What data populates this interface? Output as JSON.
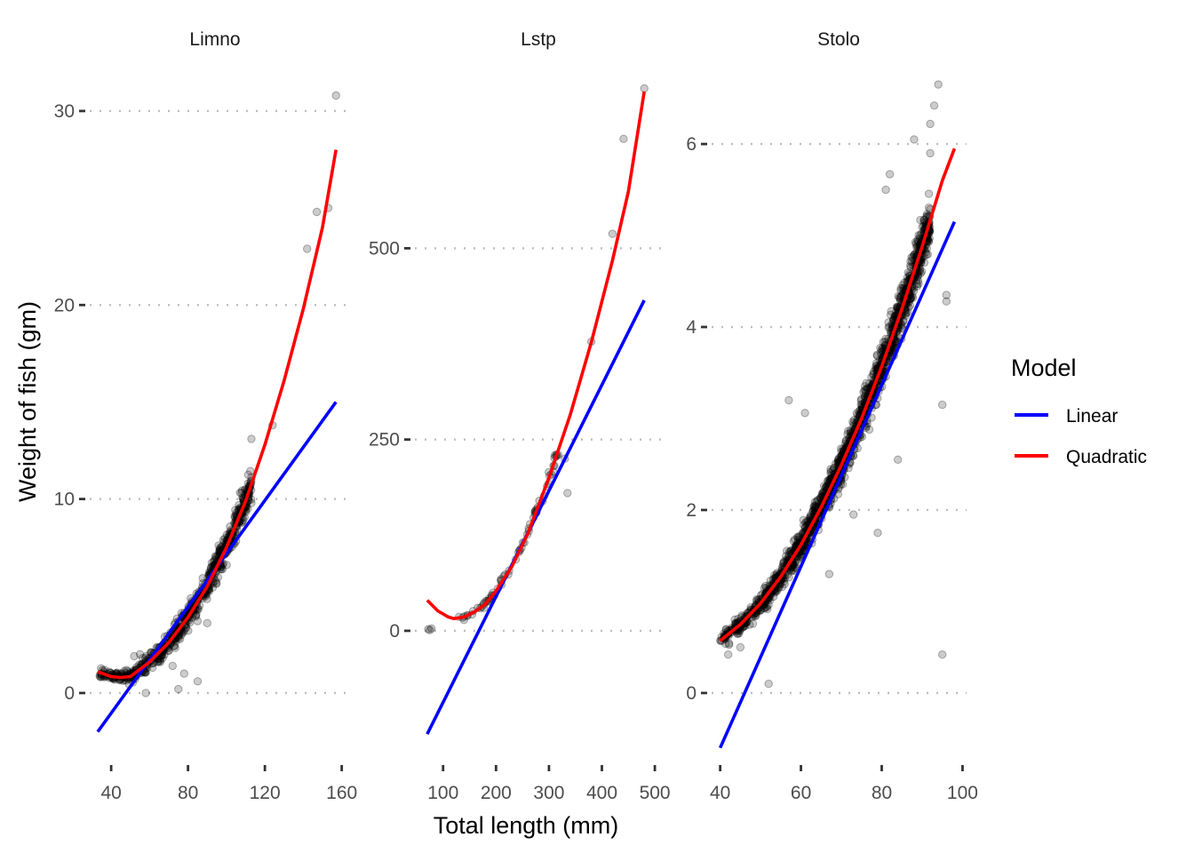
{
  "chart_data": {
    "type": "scatter",
    "layout": "faceted-3-panels",
    "xlabel": "Total length (mm)",
    "ylabel": "Weight of fish (gm)",
    "legend": {
      "title": "Model",
      "placement": "right",
      "entries": [
        {
          "name": "Linear",
          "color": "#0000ff"
        },
        {
          "name": "Quadratic",
          "color": "#ff0000"
        }
      ]
    },
    "grid": "horizontal major dotted",
    "panels": [
      {
        "title": "Limno",
        "xlim": [
          27,
          162
        ],
        "ylim": [
          -3.3,
          31.6
        ],
        "xticks": [
          40,
          80,
          120,
          160
        ],
        "yticks": [
          0,
          10,
          20,
          30
        ],
        "fits": {
          "Linear": {
            "x": [
              33,
              157
            ],
            "y": [
              -2.0,
              15.0
            ]
          },
          "Quadratic": {
            "x": [
              33,
              40,
              45,
              50,
              60,
              70,
              80,
              90,
              100,
              110,
              120,
              130,
              140,
              150,
              157
            ],
            "y": [
              1.1,
              0.85,
              0.8,
              0.85,
              1.6,
              2.6,
              3.9,
              5.5,
              7.5,
              9.9,
              12.8,
              16.1,
              19.8,
              24.0,
              28.0
            ]
          }
        },
        "cloud": {
          "x_range": [
            33,
            113
          ],
          "curve": "quadratic",
          "spread": 0.9,
          "n": 700
        },
        "outliers": [
          [
            157,
            30.8
          ],
          [
            147,
            24.8
          ],
          [
            153,
            25.0
          ],
          [
            142,
            22.9
          ],
          [
            124,
            13.8
          ],
          [
            113,
            13.1
          ],
          [
            85,
            0.6
          ],
          [
            75,
            0.2
          ],
          [
            78,
            1.0
          ],
          [
            58,
            0.0
          ],
          [
            72,
            1.4
          ],
          [
            52,
            1.9
          ],
          [
            55,
            2.0
          ],
          [
            90,
            3.6
          ]
        ]
      },
      {
        "title": "Lstp",
        "xlim": [
          40,
          525
        ],
        "ylim": [
          -165,
          720
        ],
        "xticks": [
          100,
          200,
          300,
          400,
          500
        ],
        "yticks": [
          0,
          250,
          500
        ],
        "fits": {
          "Linear": {
            "x": [
              70,
              480
            ],
            "y": [
              -135,
              432
            ]
          },
          "Quadratic": {
            "x": [
              70,
              90,
              110,
              120,
              140,
              160,
              180,
              200,
              230,
              260,
              300,
              340,
              380,
              420,
              450,
              480
            ],
            "y": [
              40,
              26,
              18,
              16,
              18,
              25,
              35,
              52,
              84,
              127,
              200,
              282,
              377,
              484,
              574,
              705
            ]
          }
        },
        "cloud": {
          "x_range": [
            120,
            320
          ],
          "curve": "quadratic",
          "spread": 10,
          "n": 70
        },
        "outliers": [
          [
            72,
            2
          ],
          [
            78,
            3
          ],
          [
            75,
            1
          ],
          [
            441,
            643
          ],
          [
            480,
            709
          ],
          [
            420,
            519
          ],
          [
            380,
            378
          ],
          [
            335,
            180
          ],
          [
            330,
            225
          ]
        ]
      },
      {
        "title": "Stolo",
        "xlim": [
          37,
          101
        ],
        "ylim": [
          -0.7,
          6.7
        ],
        "xticks": [
          40,
          60,
          80,
          100
        ],
        "yticks": [
          0,
          2,
          4,
          6
        ],
        "fits": {
          "Linear": {
            "x": [
              40,
              98
            ],
            "y": [
              -0.6,
              5.15
            ]
          },
          "Quadratic": {
            "x": [
              40,
              45,
              50,
              55,
              60,
              65,
              70,
              75,
              80,
              85,
              90,
              95,
              98
            ],
            "y": [
              0.57,
              0.75,
              0.98,
              1.27,
              1.62,
              2.03,
              2.49,
              3.0,
              3.57,
              4.2,
              4.88,
              5.6,
              5.95
            ]
          }
        },
        "cloud": {
          "x_range": [
            40,
            92
          ],
          "curve": "quadratic",
          "spread": 0.28,
          "n": 1600
        },
        "outliers": [
          [
            94,
            6.65
          ],
          [
            93,
            6.42
          ],
          [
            92,
            6.22
          ],
          [
            88,
            6.05
          ],
          [
            82,
            5.67
          ],
          [
            92,
            5.9
          ],
          [
            81,
            5.5
          ],
          [
            95,
            0.42
          ],
          [
            52,
            0.1
          ],
          [
            57,
            3.2
          ],
          [
            61,
            3.06
          ],
          [
            96,
            4.35
          ],
          [
            96,
            4.28
          ],
          [
            95,
            3.15
          ],
          [
            84,
            2.55
          ],
          [
            79,
            1.75
          ],
          [
            73,
            1.95
          ],
          [
            67,
            1.3
          ],
          [
            42,
            0.42
          ],
          [
            45,
            0.5
          ]
        ]
      }
    ]
  }
}
